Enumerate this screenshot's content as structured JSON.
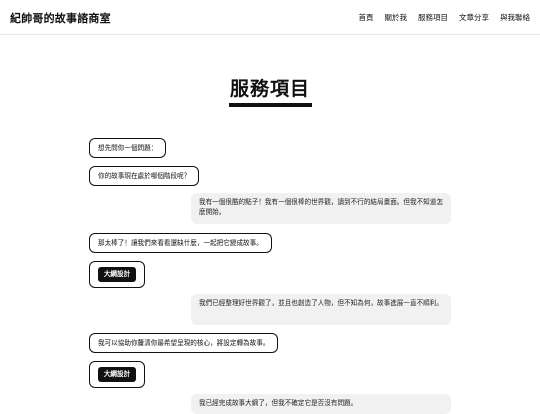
{
  "header": {
    "brand": "紀帥哥的故事諮商室",
    "nav": [
      "首頁",
      "關於我",
      "服務項目",
      "文章分享",
      "與我聯絡"
    ]
  },
  "page": {
    "title": "服務項目"
  },
  "chat": {
    "msg1": "想先問你一個問題：",
    "msg2": "你的故事現在處於哪個階段呢？",
    "reply1": "我有一個很酷的點子！我有一個很棒的世界觀，讀到不行的結局畫面。但我不知道怎麼開始。",
    "msg3": "那太棒了！讓我們來看看還缺什麼，一起把它變成故事。",
    "button1": "大綱設計",
    "reply2": "我們已經整理好世界觀了，並且也創造了人物，但不知為何，故事進展一直不順利。",
    "msg4": "我可以協助你釐清你最希望呈現的核心，將設定轉為故事。",
    "button2": "大綱設計",
    "reply3": "我已經完成故事大綱了，但我不確定它是否沒有問題。"
  }
}
